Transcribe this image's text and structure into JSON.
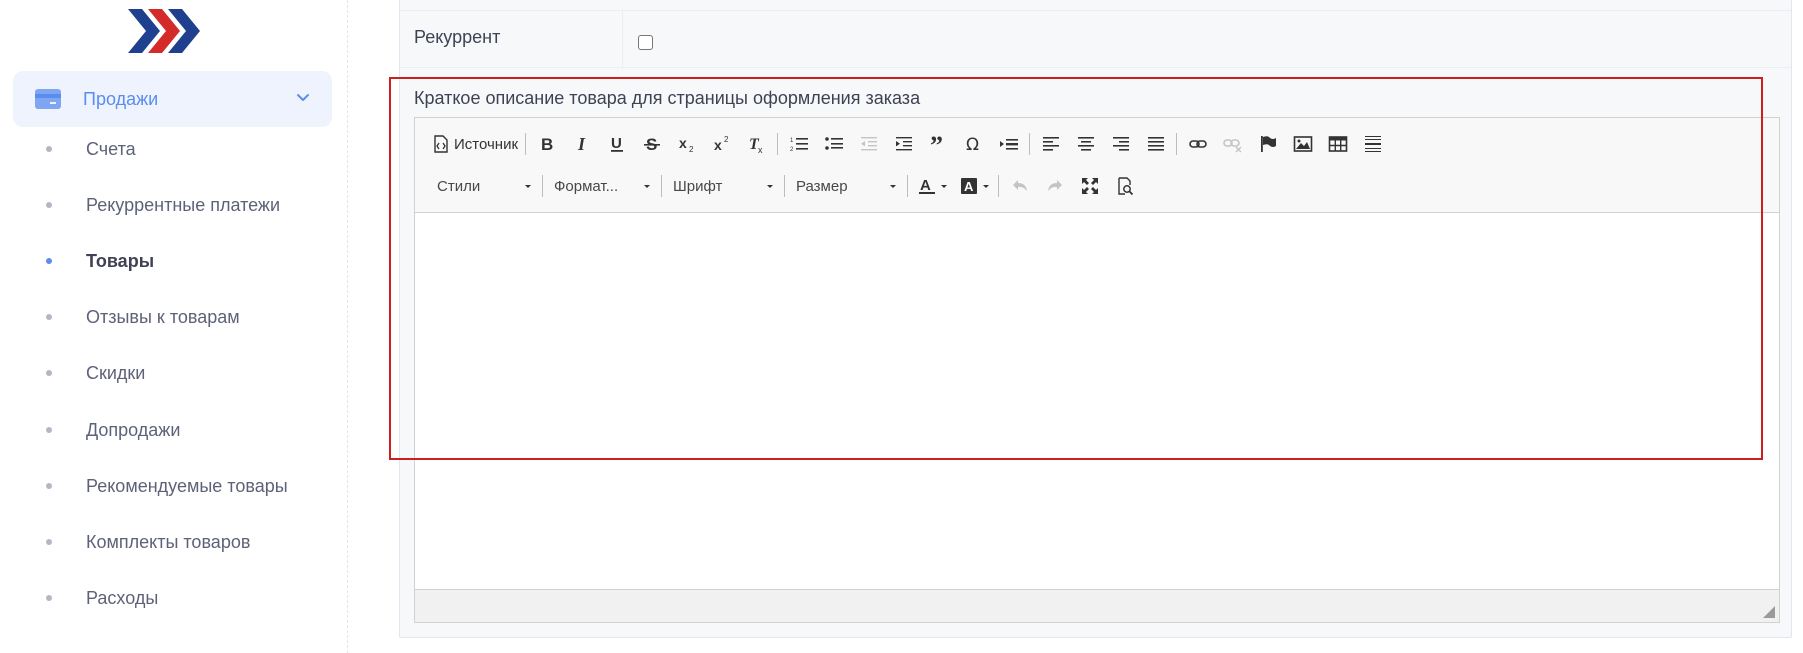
{
  "sidebar": {
    "logo": "chevron-logo",
    "parent": {
      "label": "Продажи",
      "icon": "credit-card-icon"
    },
    "items": [
      {
        "label": "Счета",
        "active": false
      },
      {
        "label": "Рекуррентные платежи",
        "active": false
      },
      {
        "label": "Товары",
        "active": true
      },
      {
        "label": "Отзывы к товарам",
        "active": false
      },
      {
        "label": "Скидки",
        "active": false
      },
      {
        "label": "Допродажи",
        "active": false
      },
      {
        "label": "Рекомендуемые товары",
        "active": false
      },
      {
        "label": "Комплекты товаров",
        "active": false
      },
      {
        "label": "Расходы",
        "active": false
      }
    ]
  },
  "form": {
    "recurrent_label": "Рекуррент",
    "recurrent_checked": false,
    "description_label": "Краткое описание товара для страницы оформления заказа"
  },
  "editor": {
    "source_label": "Источник",
    "styles_label": "Стили",
    "format_label": "Формат...",
    "font_label": "Шрифт",
    "size_label": "Размер",
    "content": ""
  },
  "colors": {
    "accent": "#5b8def",
    "highlight": "#cc2020",
    "logo_blue": "#1f3f8f",
    "logo_red": "#d42a2a"
  }
}
